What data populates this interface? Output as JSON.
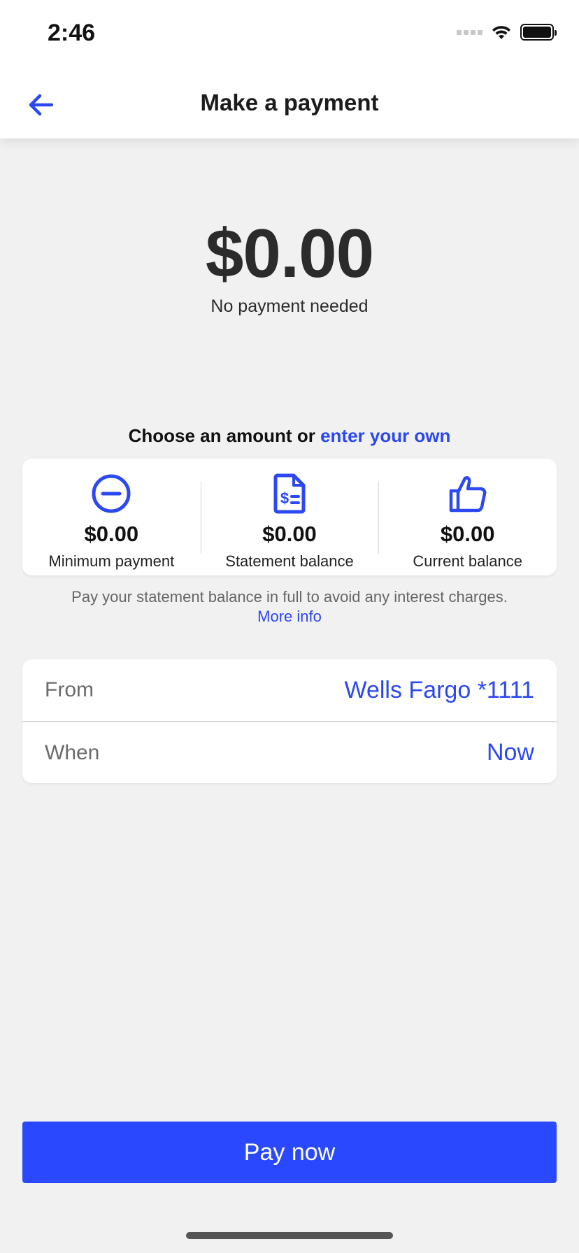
{
  "status_bar": {
    "time": "2:46"
  },
  "header": {
    "title": "Make a payment",
    "back_icon": "arrow-left-icon"
  },
  "amount": {
    "value": "$0.00",
    "note": "No payment needed"
  },
  "choose": {
    "prefix": "Choose an amount or",
    "link": "enter your own"
  },
  "options": [
    {
      "icon": "minus-circle-icon",
      "value": "$0.00",
      "label": "Minimum payment"
    },
    {
      "icon": "document-dollar-icon",
      "value": "$0.00",
      "label": "Statement balance"
    },
    {
      "icon": "thumbs-up-icon",
      "value": "$0.00",
      "label": "Current balance"
    }
  ],
  "hint": {
    "text": "Pay your statement balance in full to avoid any interest charges.",
    "link": "More info"
  },
  "details": {
    "from_label": "From",
    "from_value": "Wells Fargo *1111",
    "when_label": "When",
    "when_value": "Now"
  },
  "pay_button": {
    "label": "Pay now"
  },
  "colors": {
    "accent": "#2b48f2",
    "button": "#2a49ff",
    "background": "#f1f1f2"
  }
}
